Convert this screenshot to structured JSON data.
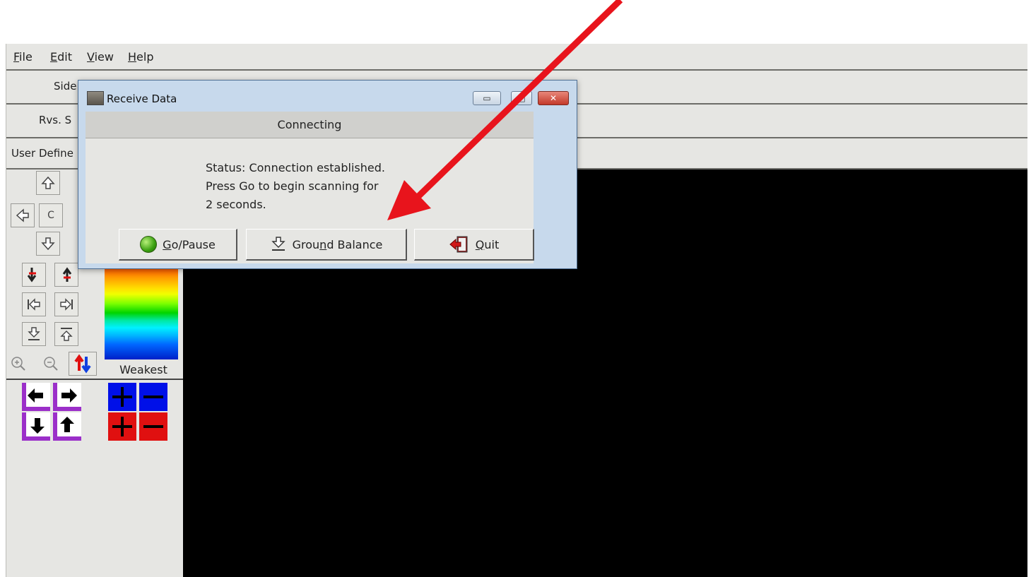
{
  "menu": {
    "file": "File",
    "edit": "Edit",
    "view": "View",
    "help": "Help"
  },
  "toolbar": {
    "row1_label": "Side",
    "row2_label": "Rvs. S",
    "row3_label": "User Define"
  },
  "nav": {
    "center_label": "C"
  },
  "palette": {
    "weakest_label": "Weakest"
  },
  "dialog": {
    "title": "Receive Data",
    "header": "Connecting",
    "status_line1": "Status: Connection established.",
    "status_line2": "Press Go to begin scanning for",
    "status_line3": "2 seconds.",
    "buttons": {
      "go_pause": "Go/Pause",
      "ground_balance": "Ground Balance",
      "quit": "Quit"
    }
  },
  "colors": {
    "annotation_arrow": "#e8141c",
    "display_bg": "#000000"
  }
}
